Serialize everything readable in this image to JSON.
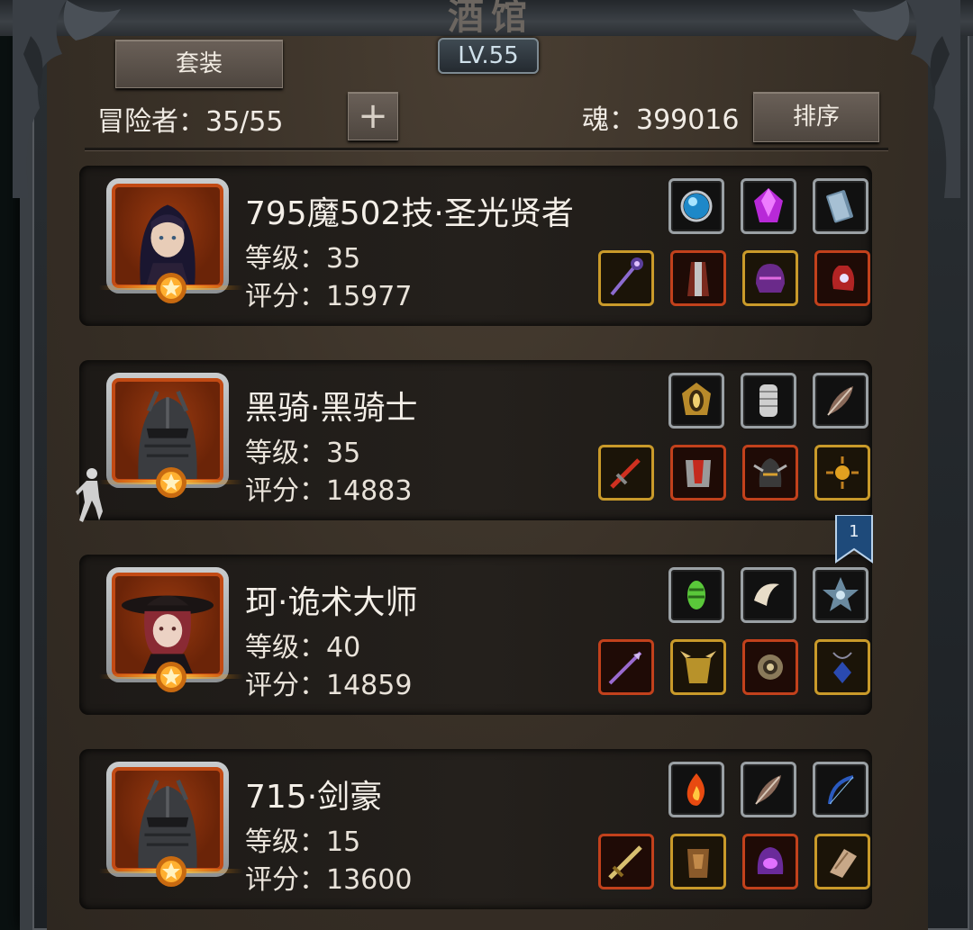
{
  "header": {
    "title": "酒馆",
    "level_badge": "LV.55",
    "suit_button": "套装",
    "plus_button": "+",
    "sort_button": "排序",
    "adventurers": "冒险者：35/55",
    "soul": "魂：399016"
  },
  "bookmark": {
    "label": "1"
  },
  "colors": {
    "panel": "#3b3228",
    "card": "#1f1c19",
    "gold_frame": "#c99a2a",
    "red_frame": "#c2411c",
    "gray_frame": "#9aa0a4",
    "lv_badge_border": "#7d8a92"
  },
  "heroes": [
    {
      "name": "795魔502技·圣光贤者",
      "level": "等级：35",
      "score": "评分：15977",
      "portrait": "female-mage-portrait",
      "top_slots": [
        {
          "icon": "blue-orb-icon",
          "frame": "gray"
        },
        {
          "icon": "purple-gem-icon",
          "frame": "gray"
        },
        {
          "icon": "tome-icon",
          "frame": "gray"
        }
      ],
      "bottom_slots": [
        {
          "icon": "staff-icon",
          "frame": "gold"
        },
        {
          "icon": "robe-icon",
          "frame": "red"
        },
        {
          "icon": "helm-icon",
          "frame": "gold"
        },
        {
          "icon": "glove-icon",
          "frame": "red"
        }
      ]
    },
    {
      "name": "黑骑·黑骑士",
      "level": "等级：35",
      "score": "评分：14883",
      "portrait": "black-knight-helm-portrait",
      "top_slots": [
        {
          "icon": "gold-amulet-icon",
          "frame": "gray"
        },
        {
          "icon": "chainmail-icon",
          "frame": "gray"
        },
        {
          "icon": "feather-icon",
          "frame": "gray"
        }
      ],
      "bottom_slots": [
        {
          "icon": "red-sword-icon",
          "frame": "gold"
        },
        {
          "icon": "armor-icon",
          "frame": "red"
        },
        {
          "icon": "winged-helm-icon",
          "frame": "red"
        },
        {
          "icon": "sun-ring-icon",
          "frame": "gold"
        }
      ]
    },
    {
      "name": "珂·诡术大师",
      "level": "等级：40",
      "score": "评分：14859",
      "portrait": "red-haired-witch-portrait",
      "top_slots": [
        {
          "icon": "green-crystal-icon",
          "frame": "gray"
        },
        {
          "icon": "horn-icon",
          "frame": "gray"
        },
        {
          "icon": "star-emblem-icon",
          "frame": "gray"
        }
      ],
      "bottom_slots": [
        {
          "icon": "dark-spear-icon",
          "frame": "red"
        },
        {
          "icon": "spiked-armor-icon",
          "frame": "gold"
        },
        {
          "icon": "shield-ring-icon",
          "frame": "red"
        },
        {
          "icon": "pendant-icon",
          "frame": "gold"
        }
      ]
    },
    {
      "name": "715·剑豪",
      "level": "等级：15",
      "score": "评分：13600",
      "portrait": "black-knight-helm-portrait",
      "top_slots": [
        {
          "icon": "fire-orb-icon",
          "frame": "gray"
        },
        {
          "icon": "feather-icon",
          "frame": "gray"
        },
        {
          "icon": "bow-icon",
          "frame": "gray"
        }
      ],
      "bottom_slots": [
        {
          "icon": "golden-sword-icon",
          "frame": "red"
        },
        {
          "icon": "bronze-armor-icon",
          "frame": "gold"
        },
        {
          "icon": "purple-helm-icon",
          "frame": "red"
        },
        {
          "icon": "gauntlet-icon",
          "frame": "gold"
        }
      ]
    }
  ]
}
